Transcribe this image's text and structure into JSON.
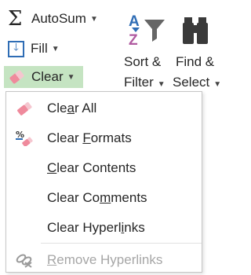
{
  "ribbon": {
    "autosum_label": "AutoSum",
    "fill_label": "Fill",
    "clear_label": "Clear",
    "sort_filter": {
      "line1": "Sort &",
      "line2": "Filter"
    },
    "find_select": {
      "line1": "Find &",
      "line2": "Select"
    },
    "active_color": "#c5e4c2"
  },
  "menu": {
    "items": [
      {
        "pre": "Cle",
        "acc": "a",
        "post": "r All",
        "icon": "eraser-icon",
        "enabled": true
      },
      {
        "pre": "Clear ",
        "acc": "F",
        "post": "ormats",
        "icon": "clear-formats-icon",
        "enabled": true
      },
      {
        "pre": "",
        "acc": "C",
        "post": "lear Contents",
        "icon": "",
        "enabled": true
      },
      {
        "pre": "Clear Co",
        "acc": "m",
        "post": "ments",
        "icon": "",
        "enabled": true
      },
      {
        "pre": "Clear Hyperl",
        "acc": "i",
        "post": "nks",
        "icon": "",
        "enabled": true
      },
      {
        "pre": "",
        "acc": "R",
        "post": "emove Hyperlinks",
        "icon": "remove-hyperlinks-icon",
        "enabled": false
      }
    ]
  }
}
